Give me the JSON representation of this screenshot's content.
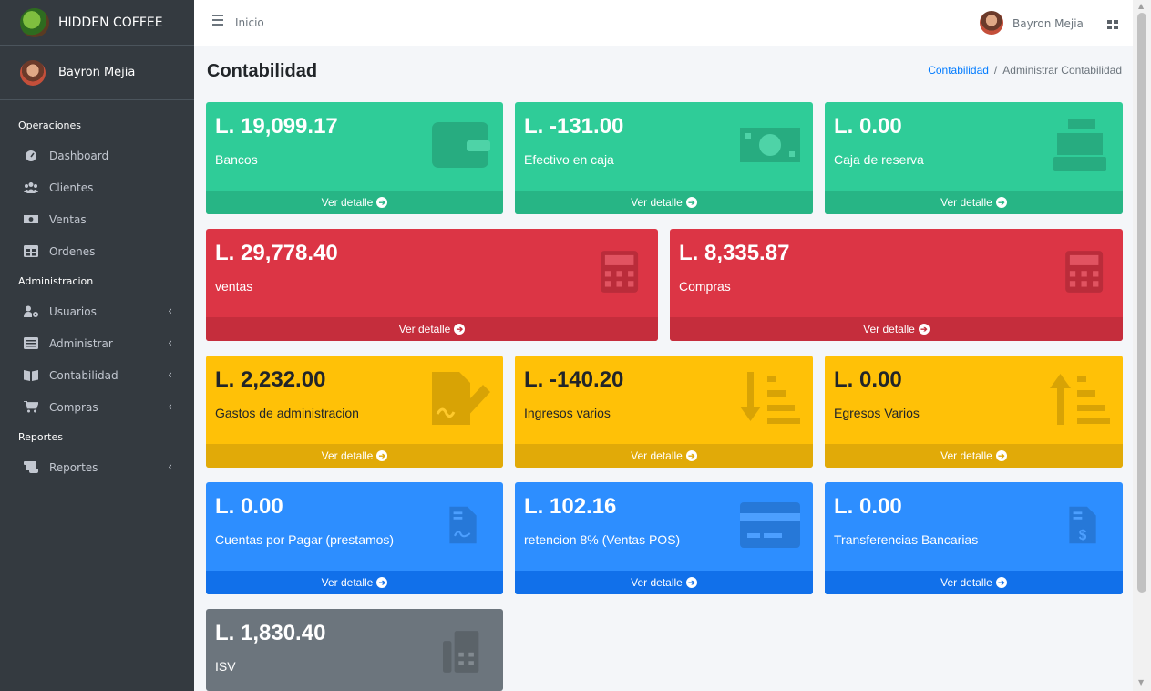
{
  "brand": {
    "name": "HIDDEN COFFEE"
  },
  "user": {
    "name": "Bayron Mejia"
  },
  "topbar": {
    "home": "Inicio",
    "user_name": "Bayron Mejia"
  },
  "sidebar": {
    "header_operaciones": "Operaciones",
    "header_administracion": "Administracion",
    "header_reportes": "Reportes",
    "items": [
      {
        "label": "Dashboard",
        "icon": "tachometer-icon"
      },
      {
        "label": "Clientes",
        "icon": "users-icon"
      },
      {
        "label": "Ventas",
        "icon": "money-bill-icon"
      },
      {
        "label": "Ordenes",
        "icon": "table-icon"
      },
      {
        "label": "Usuarios",
        "icon": "user-cog-icon"
      },
      {
        "label": "Administrar",
        "icon": "list-alt-icon"
      },
      {
        "label": "Contabilidad",
        "icon": "book-open-icon"
      },
      {
        "label": "Compras",
        "icon": "shopping-cart-icon"
      },
      {
        "label": "Reportes",
        "icon": "scroll-icon"
      }
    ]
  },
  "page": {
    "title": "Contabilidad",
    "breadcrumb_link": "Contabilidad",
    "breadcrumb_separator": "/",
    "breadcrumb_current": "Administrar Contabilidad"
  },
  "footer_label": "Ver detalle",
  "boxes": [
    {
      "value": "L. 19,099.17",
      "label": "Bancos",
      "color": "green",
      "icon": "wallet-icon"
    },
    {
      "value": "L. -131.00",
      "label": "Efectivo en caja",
      "color": "green",
      "icon": "money-bill-icon"
    },
    {
      "value": "L. 0.00",
      "label": "Caja de reserva",
      "color": "green",
      "icon": "cash-register-icon"
    },
    {
      "value": "L. 29,778.40",
      "label": "ventas",
      "color": "red",
      "icon": "calculator-icon"
    },
    {
      "value": "L. 8,335.87",
      "label": "Compras",
      "color": "red",
      "icon": "calculator-icon"
    },
    {
      "value": "L. 2,232.00",
      "label": "Gastos de administracion",
      "color": "yellow",
      "icon": "file-signature-icon"
    },
    {
      "value": "L. -140.20",
      "label": "Ingresos varios",
      "color": "yellow",
      "icon": "sort-amount-down-icon"
    },
    {
      "value": "L. 0.00",
      "label": "Egresos Varios",
      "color": "yellow",
      "icon": "sort-amount-up-icon"
    },
    {
      "value": "L. 0.00",
      "label": "Cuentas por Pagar (prestamos)",
      "color": "blue",
      "icon": "file-contract-icon"
    },
    {
      "value": "L. 102.16",
      "label": "retencion 8% (Ventas POS)",
      "color": "blue",
      "icon": "credit-card-icon"
    },
    {
      "value": "L. 0.00",
      "label": "Transferencias Bancarias",
      "color": "blue",
      "icon": "file-invoice-dollar-icon"
    },
    {
      "value": "L. 1,830.40",
      "label": "ISV",
      "color": "gray",
      "icon": "fax-icon"
    }
  ],
  "colors": {
    "sidebar": "#343a40",
    "green": "#2fcc98",
    "red": "#dc3545",
    "yellow": "#ffc107",
    "blue": "#2d8eff",
    "gray": "#6c757d",
    "link": "#007bff"
  }
}
